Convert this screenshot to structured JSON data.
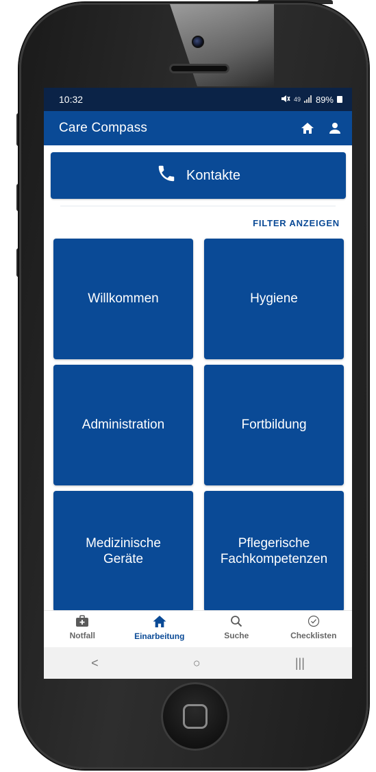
{
  "status_bar": {
    "time": "10:32",
    "signal_text": "49",
    "battery": "89%"
  },
  "app_bar": {
    "title": "Care Compass",
    "home_icon": "home-icon",
    "profile_icon": "user-icon"
  },
  "contacts": {
    "label": "Kontakte",
    "icon": "phone-icon"
  },
  "filter": {
    "label": "FILTER ANZEIGEN"
  },
  "tiles": [
    {
      "label": "Willkommen"
    },
    {
      "label": "Hygiene"
    },
    {
      "label": "Administration"
    },
    {
      "label": "Fortbildung"
    },
    {
      "label": "Medizinische Geräte"
    },
    {
      "label": "Pflegerische Fachkompetenzen"
    }
  ],
  "bottom_nav": {
    "items": [
      {
        "label": "Notfall",
        "icon": "first-aid-icon"
      },
      {
        "label": "Einarbeitung",
        "icon": "home-icon",
        "active": true
      },
      {
        "label": "Suche",
        "icon": "search-icon"
      },
      {
        "label": "Checklisten",
        "icon": "check-circle-icon"
      }
    ]
  },
  "system_nav": {
    "back": "<",
    "home": "○",
    "recents": "|||"
  },
  "colors": {
    "primary": "#0a4a96",
    "status_bar": "#0b2347",
    "text_on_primary": "#ffffff"
  }
}
